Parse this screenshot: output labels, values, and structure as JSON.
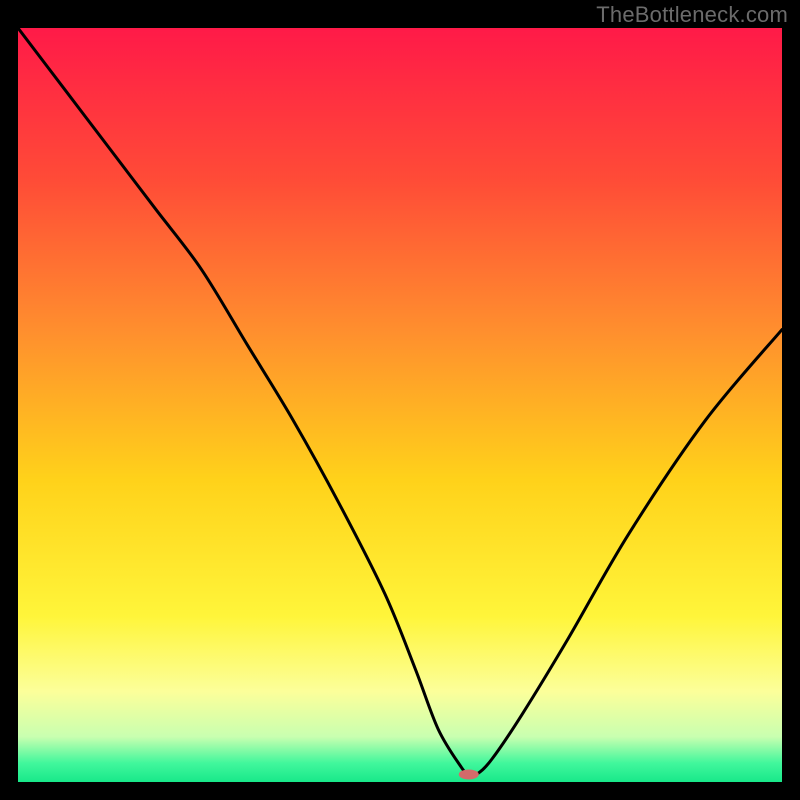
{
  "watermark": "TheBottleneck.com",
  "chart_data": {
    "type": "line",
    "title": "",
    "xlabel": "",
    "ylabel": "",
    "xlim": [
      0,
      100
    ],
    "ylim": [
      0,
      100
    ],
    "background_gradient": {
      "stops": [
        {
          "offset": 0.0,
          "color": "#ff1a48"
        },
        {
          "offset": 0.2,
          "color": "#ff4b37"
        },
        {
          "offset": 0.4,
          "color": "#ff8e2e"
        },
        {
          "offset": 0.6,
          "color": "#ffd21a"
        },
        {
          "offset": 0.78,
          "color": "#fff53a"
        },
        {
          "offset": 0.88,
          "color": "#fcff9a"
        },
        {
          "offset": 0.94,
          "color": "#c9ffb0"
        },
        {
          "offset": 0.975,
          "color": "#41f79c"
        },
        {
          "offset": 1.0,
          "color": "#18e88a"
        }
      ]
    },
    "series": [
      {
        "name": "bottleneck-curve",
        "x": [
          0,
          6,
          12,
          18,
          24,
          30,
          36,
          42,
          48,
          52,
          55,
          58,
          59,
          60,
          62,
          66,
          72,
          80,
          90,
          100
        ],
        "y": [
          100,
          92,
          84,
          76,
          68,
          58,
          48,
          37,
          25,
          15,
          7,
          2,
          1,
          1,
          3,
          9,
          19,
          33,
          48,
          60
        ]
      }
    ],
    "marker": {
      "name": "optimal-point",
      "x": 59,
      "y": 1,
      "color": "#d46a6a",
      "rx": 10,
      "ry": 5
    }
  }
}
